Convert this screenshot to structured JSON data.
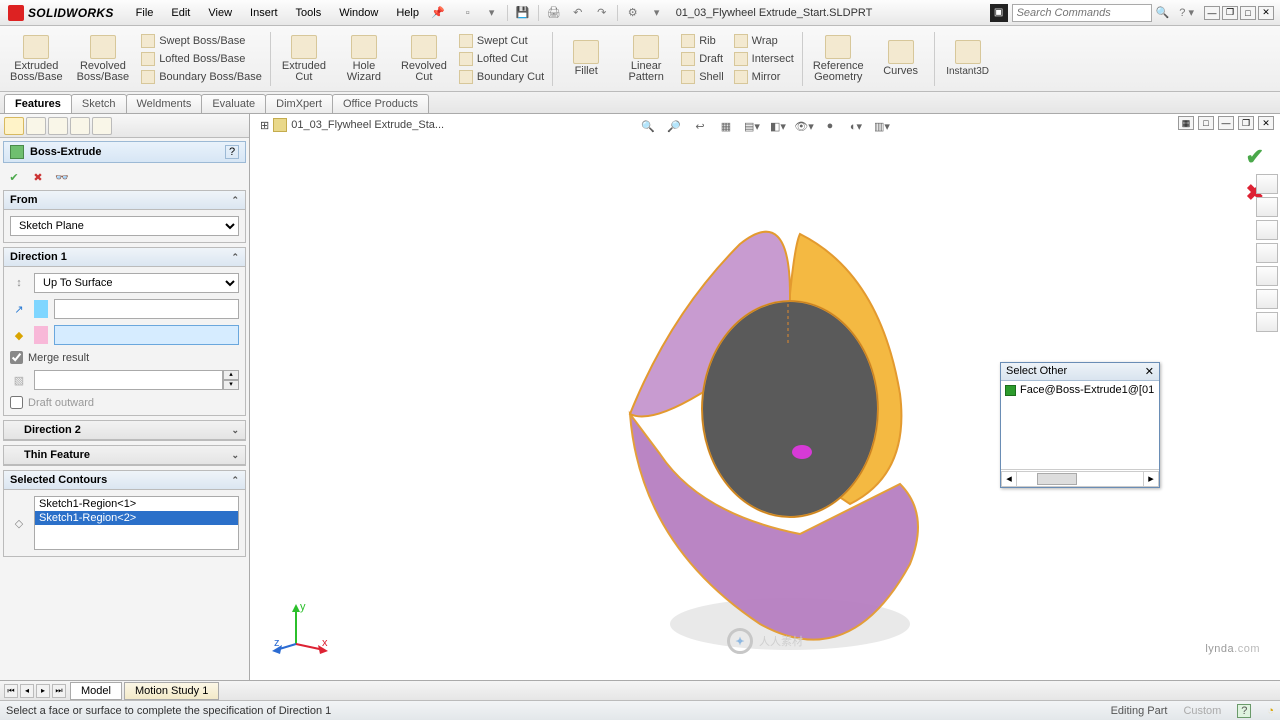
{
  "app": {
    "brand": "SOLIDWORKS"
  },
  "menu": [
    "File",
    "Edit",
    "View",
    "Insert",
    "Tools",
    "Window",
    "Help"
  ],
  "doc_name": "01_03_Flywheel Extrude_Start.SLDPRT",
  "search_placeholder": "Search Commands",
  "ribbon": {
    "big": [
      {
        "l1": "Extruded",
        "l2": "Boss/Base"
      },
      {
        "l1": "Revolved",
        "l2": "Boss/Base"
      }
    ],
    "boss_mini": [
      "Swept Boss/Base",
      "Lofted Boss/Base",
      "Boundary Boss/Base"
    ],
    "cut_big": [
      {
        "l1": "Extruded",
        "l2": "Cut"
      },
      {
        "l1": "Hole",
        "l2": "Wizard"
      },
      {
        "l1": "Revolved",
        "l2": "Cut"
      }
    ],
    "cut_mini": [
      "Swept Cut",
      "Lofted Cut",
      "Boundary Cut"
    ],
    "feat_big": [
      {
        "l1": "Fillet",
        "l2": ""
      },
      {
        "l1": "Linear",
        "l2": "Pattern"
      }
    ],
    "feat_mini": [
      "Rib",
      "Draft",
      "Shell"
    ],
    "feat_mini2": [
      "Wrap",
      "Intersect",
      "Mirror"
    ],
    "ref_big": [
      {
        "l1": "Reference",
        "l2": "Geometry"
      },
      {
        "l1": "Curves",
        "l2": ""
      }
    ],
    "instant": "Instant3D"
  },
  "tabs": [
    "Features",
    "Sketch",
    "Weldments",
    "Evaluate",
    "DimXpert",
    "Office Products"
  ],
  "pm": {
    "title": "Boss-Extrude",
    "from": {
      "head": "From",
      "value": "Sketch Plane"
    },
    "dir1": {
      "head": "Direction 1",
      "end": "Up To Surface",
      "merge": "Merge result",
      "draft": "Draft outward"
    },
    "dir2_head": "Direction 2",
    "thin_head": "Thin Feature",
    "contours": {
      "head": "Selected Contours",
      "items": [
        "Sketch1-Region<1>",
        "Sketch1-Region<2>"
      ]
    }
  },
  "breadcrumb": "01_03_Flywheel Extrude_Sta...",
  "select_other": {
    "title": "Select Other",
    "item": "Face@Boss-Extrude1@[01"
  },
  "bottom_tabs": [
    "Model",
    "Motion Study 1"
  ],
  "status": {
    "msg": "Select a face or surface to complete the specification of Direction 1",
    "mode": "Editing Part",
    "sys": "Custom"
  },
  "watermark": {
    "brand": "lynda",
    "suffix": ".com",
    "center": "人人素材"
  }
}
